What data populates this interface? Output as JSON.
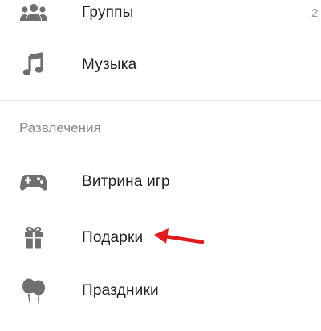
{
  "menu": {
    "items_top": [
      {
        "label": "Группы",
        "icon": "groups-icon",
        "badge": "2"
      },
      {
        "label": "Музыка",
        "icon": "music-note-icon"
      }
    ],
    "section_title": "Развлечения",
    "items_section": [
      {
        "label": "Витрина игр",
        "icon": "gamepad-icon"
      },
      {
        "label": "Подарки",
        "icon": "gift-icon"
      },
      {
        "label": "Праздники",
        "icon": "balloons-icon"
      }
    ]
  },
  "colors": {
    "icon": "#6f6f6f",
    "text": "#222222",
    "section_title": "#8a8a8a",
    "annotation_arrow": "#e31a1c"
  }
}
